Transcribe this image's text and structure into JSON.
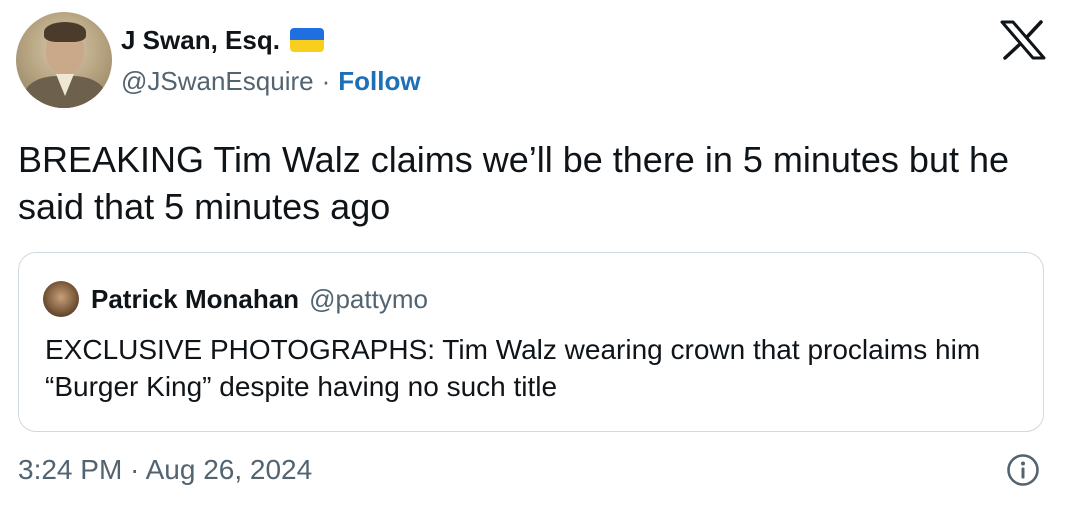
{
  "author": {
    "name": "J Swan, Esq.",
    "handle": "@JSwanEsquire",
    "separator": "·",
    "follow_label": "Follow",
    "flag_icon": "ukraine-flag-icon"
  },
  "tweet": {
    "text": "BREAKING Tim Walz claims we’ll be there in 5 minutes but he said that 5 minutes ago",
    "timestamp": "3:24 PM · Aug 26, 2024"
  },
  "quoted_tweet": {
    "name": "Patrick Monahan",
    "handle": "@pattymo",
    "text": "EXCLUSIVE PHOTOGRAPHS: Tim Walz wearing crown that proclaims him “Burger King” despite having no such title"
  },
  "colors": {
    "text_primary": "#0f1419",
    "text_secondary": "#536471",
    "follow_blue": "#1d6fb8",
    "border": "#cfd9de"
  },
  "icons": {
    "platform": "x-logo-icon",
    "info": "info-icon"
  }
}
